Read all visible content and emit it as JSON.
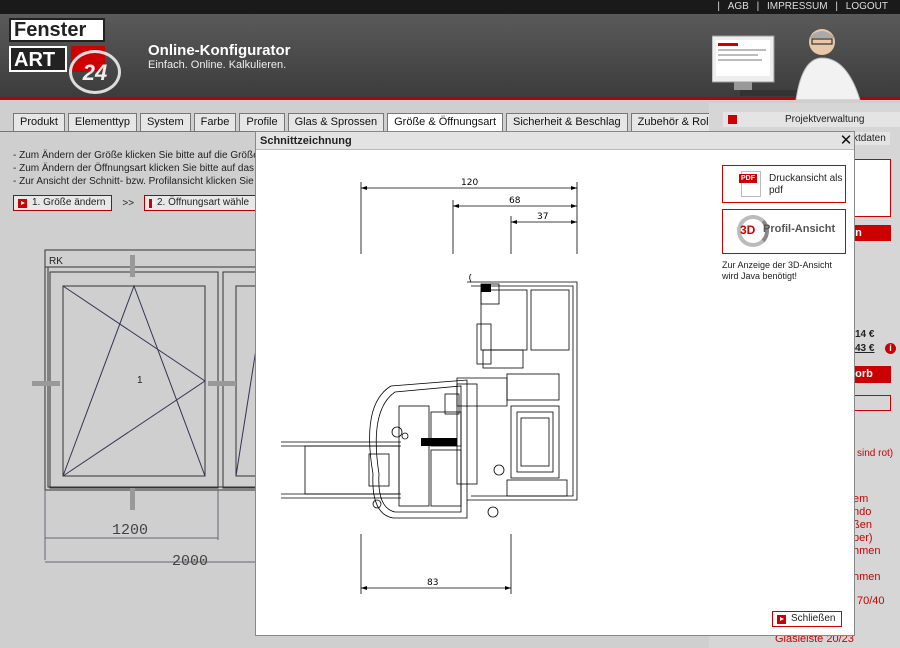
{
  "topnav": {
    "agb": "AGB",
    "impressum": "IMPRESSUM",
    "logout": "LOGOUT",
    "sep": "|"
  },
  "header": {
    "logo_line1": "Fenster",
    "logo_line2": "ART",
    "logo_badge": "24",
    "title": "Online-Konfigurator",
    "subtitle": "Einfach. Online. Kalkulieren."
  },
  "tabs": [
    "Produkt",
    "Elementtyp",
    "System",
    "Farbe",
    "Profile",
    "Glas & Sprossen",
    "Größe & Öffnungsart",
    "Sicherheit & Beschlag",
    "Zubehör & Rollladen"
  ],
  "active_tab": "Größe & Öffnungsart",
  "instructions": [
    "- Zum Ändern der Größe klicken Sie bitte auf die Größe",
    "- Zum Ändern der Öffnungsart klicken Sie bitte auf das",
    "- Zur Ansicht der Schnitt- bzw. Profilansicht klicken Sie"
  ],
  "steps": {
    "step1": "1. Größe ändern",
    "sep": ">>",
    "step2": "2. Öffnungsart wähle"
  },
  "window_drawing": {
    "label_rk": "RK",
    "sash_number": "1",
    "dim_inner": "1200",
    "dim_outer": "2000"
  },
  "sidebar": {
    "projektverwaltung": "Projektverwaltung",
    "frag_ktdaten": "ktdaten",
    "frag_en": "en",
    "frag_price1": "14 €",
    "frag_price2": "43 €",
    "frag_korb": "korb",
    "frag_sindrot": "sind rot)",
    "frag_r": "r",
    "list": [
      "em",
      "ndo",
      "ßen",
      "per)",
      "hmen",
      "",
      "hmen"
    ],
    "frag_7040": "70/40",
    "frag_bottom": "Glasleiste 20/23"
  },
  "modal": {
    "title": "Schnittzeichnung",
    "close_x": "✕",
    "dims": {
      "d120": "120",
      "d68": "68",
      "d37": "37",
      "d83": "83"
    },
    "pdf_icon_label": "PDF",
    "pdf_button": "Druckansicht als pdf",
    "profil_3d_icon": "3D",
    "profil_button": "Profil-Ansicht",
    "java_note": "Zur Anzeige der 3D-Ansicht wird Java benötigt!",
    "close_button": "Schließen"
  },
  "colors": {
    "accent": "#cc0000",
    "header_bg": "#444444",
    "page_bg": "#cfcfcf"
  }
}
